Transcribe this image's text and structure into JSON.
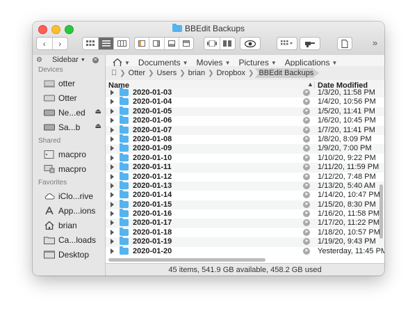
{
  "window": {
    "title": "BBEdit Backups"
  },
  "toolbar": {
    "back_icon": "chevron-left-icon",
    "forward_icon": "chevron-right-icon",
    "view_modes": [
      "icon-view",
      "list-view",
      "column-view"
    ],
    "active_view": "list-view",
    "overflow_label": "»"
  },
  "pathbar": {
    "items": [
      {
        "label": "Documents"
      },
      {
        "label": "Movies"
      },
      {
        "label": "Pictures"
      },
      {
        "label": "Applications"
      }
    ]
  },
  "breadcrumbs": [
    "Otter",
    "Users",
    "brian",
    "Dropbox",
    "BBEdit Backups"
  ],
  "sidebar": {
    "title": "Sidebar",
    "sections": [
      {
        "title": "Devices",
        "items": [
          {
            "label": "otter",
            "icon": "computer-icon"
          },
          {
            "label": "Otter",
            "icon": "disk-icon"
          },
          {
            "label": "Ne...ed",
            "icon": "external-disk-icon",
            "eject": true
          },
          {
            "label": "Sa...b",
            "icon": "external-disk-icon",
            "eject": true
          }
        ]
      },
      {
        "title": "Shared",
        "items": [
          {
            "label": "macpro",
            "icon": "server-icon"
          },
          {
            "label": "macpro",
            "icon": "display-icon"
          }
        ]
      },
      {
        "title": "Favorites",
        "items": [
          {
            "label": "iClo...rive",
            "icon": "cloud-icon"
          },
          {
            "label": "App...ions",
            "icon": "applications-icon"
          },
          {
            "label": "brian",
            "icon": "home-icon"
          },
          {
            "label": "Ca...loads",
            "icon": "folder-icon"
          },
          {
            "label": "Desktop",
            "icon": "desktop-icon"
          }
        ]
      }
    ]
  },
  "list": {
    "columns": {
      "name": "Name",
      "date": "Date Modified"
    },
    "rows": [
      {
        "name": "2020-01-03",
        "date": "1/3/20, 11:58 PM"
      },
      {
        "name": "2020-01-04",
        "date": "1/4/20, 10:56 PM"
      },
      {
        "name": "2020-01-05",
        "date": "1/5/20, 11:41 PM"
      },
      {
        "name": "2020-01-06",
        "date": "1/6/20, 10:45 PM"
      },
      {
        "name": "2020-01-07",
        "date": "1/7/20, 11:41 PM"
      },
      {
        "name": "2020-01-08",
        "date": "1/8/20, 8:09 PM"
      },
      {
        "name": "2020-01-09",
        "date": "1/9/20, 7:00 PM"
      },
      {
        "name": "2020-01-10",
        "date": "1/10/20, 9:22 PM"
      },
      {
        "name": "2020-01-11",
        "date": "1/11/20, 11:59 PM"
      },
      {
        "name": "2020-01-12",
        "date": "1/12/20, 7:48 PM"
      },
      {
        "name": "2020-01-13",
        "date": "1/13/20, 5:40 AM"
      },
      {
        "name": "2020-01-14",
        "date": "1/14/20, 10:47 PM"
      },
      {
        "name": "2020-01-15",
        "date": "1/15/20, 8:30 PM"
      },
      {
        "name": "2020-01-16",
        "date": "1/16/20, 11:58 PM"
      },
      {
        "name": "2020-01-17",
        "date": "1/17/20, 11:22 PM"
      },
      {
        "name": "2020-01-18",
        "date": "1/18/20, 10:57 PM"
      },
      {
        "name": "2020-01-19",
        "date": "1/19/20, 9:43 PM"
      },
      {
        "name": "2020-01-20",
        "date": "Yesterday, 11:45 PM"
      }
    ]
  },
  "status": {
    "text": "45 items, 541.9 GB available, 458.2 GB used"
  },
  "colors": {
    "folder": "#55b3ee",
    "close": "#fe5f57",
    "minimize": "#febc2e",
    "zoom": "#28c840"
  }
}
